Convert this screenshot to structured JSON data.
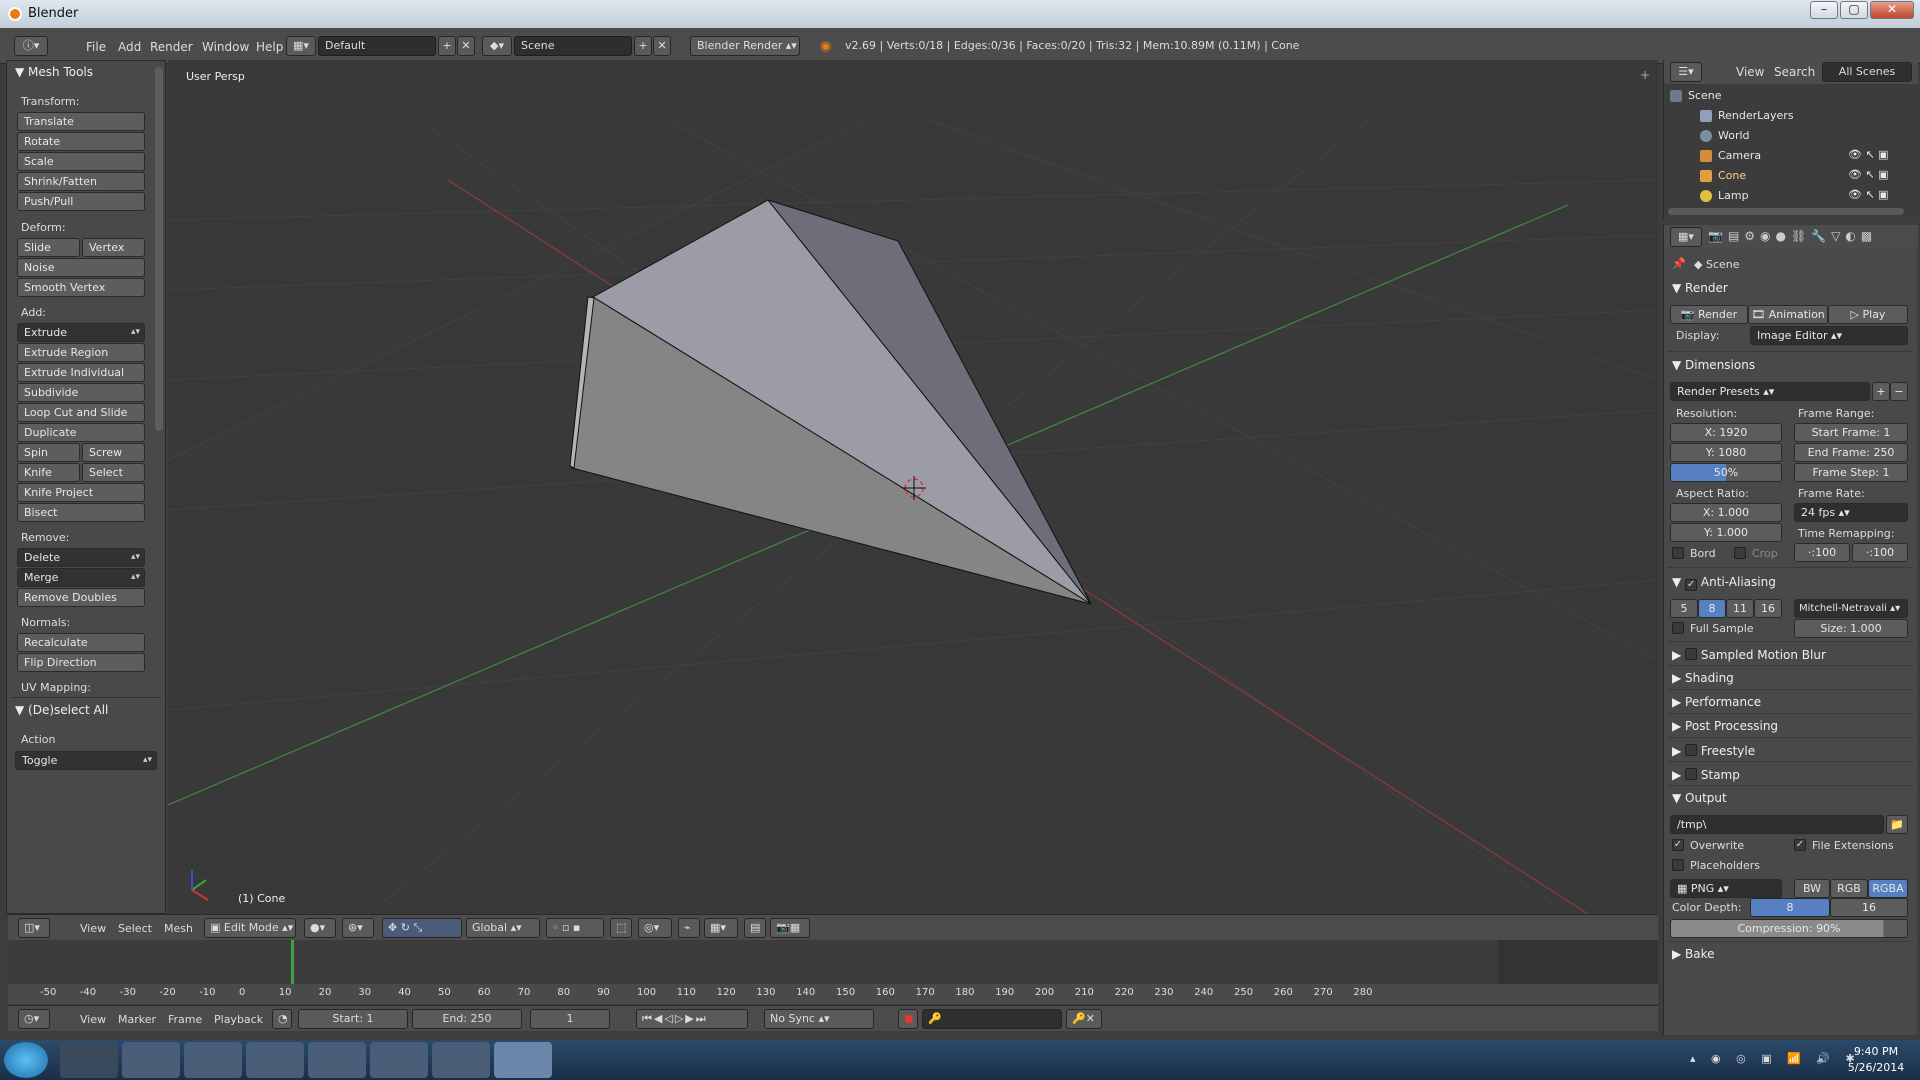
{
  "window": {
    "title": "Blender",
    "min": "–",
    "max": "▢",
    "close": "✕"
  },
  "info_header": {
    "menus": [
      "File",
      "Add",
      "Render",
      "Window",
      "Help"
    ],
    "layout": "Default",
    "scene": "Scene",
    "engine": "Blender Render",
    "stats": "v2.69 | Verts:0/18 | Edges:0/36 | Faces:0/20 | Tris:32 | Mem:10.89M (0.11M) | Cone"
  },
  "toolshelf": {
    "title": "Mesh Tools",
    "transform_label": "Transform:",
    "transform": [
      "Translate",
      "Rotate",
      "Scale",
      "Shrink/Fatten",
      "Push/Pull"
    ],
    "deform_label": "Deform:",
    "slide_edge": "Slide Edge",
    "vertex": "Vertex",
    "noise": "Noise",
    "smooth_vertex": "Smooth Vertex",
    "add_label": "Add:",
    "extrude": "Extrude",
    "extrude_region": "Extrude Region",
    "extrude_individual": "Extrude Individual",
    "subdivide": "Subdivide",
    "loop_cut": "Loop Cut and Slide",
    "duplicate": "Duplicate",
    "spin": "Spin",
    "screw": "Screw",
    "knife": "Knife",
    "select": "Select",
    "knife_project": "Knife Project",
    "bisect": "Bisect",
    "remove_label": "Remove:",
    "delete": "Delete",
    "merge": "Merge",
    "remove_doubles": "Remove Doubles",
    "normals_label": "Normals:",
    "recalculate": "Recalculate",
    "flip_direction": "Flip Direction",
    "uv_label": "UV Mapping:",
    "deselect_title": "(De)select All",
    "action_label": "Action",
    "action_value": "Toggle"
  },
  "viewport": {
    "label": "User Persp",
    "object": "(1) Cone"
  },
  "view3d_header": {
    "menus": [
      "View",
      "Select",
      "Mesh"
    ],
    "mode": "Edit Mode",
    "orientation": "Global"
  },
  "timeline": {
    "ticks": [
      "-50",
      "-40",
      "-30",
      "-20",
      "-10",
      "0",
      "10",
      "20",
      "30",
      "40",
      "50",
      "60",
      "70",
      "80",
      "90",
      "100",
      "110",
      "120",
      "130",
      "140",
      "150",
      "160",
      "170",
      "180",
      "190",
      "200",
      "210",
      "220",
      "230",
      "240",
      "250",
      "260",
      "270",
      "280"
    ],
    "menus": [
      "View",
      "Marker",
      "Frame",
      "Playback"
    ],
    "start": "Start: 1",
    "end": "End: 250",
    "current": "1",
    "sync": "No Sync"
  },
  "outliner": {
    "menus": [
      "View",
      "Search"
    ],
    "scope": "All Scenes",
    "items": [
      "Scene",
      "RenderLayers",
      "World",
      "Camera",
      "Cone",
      "Lamp"
    ]
  },
  "properties": {
    "context": "Scene",
    "render_title": "Render",
    "render_btn": "Render",
    "animation_btn": "Animation",
    "play_btn": "Play",
    "display_label": "Display:",
    "display_value": "Image Editor",
    "dimensions_title": "Dimensions",
    "presets": "Render Presets",
    "resolution_label": "Resolution:",
    "res_x": "X: 1920",
    "res_y": "Y: 1080",
    "res_pct": "50%",
    "frame_range_label": "Frame Range:",
    "start_frame": "Start Frame: 1",
    "end_frame": "End Frame: 250",
    "frame_step": "Frame Step: 1",
    "aspect_label": "Aspect Ratio:",
    "asp_x": "X: 1.000",
    "asp_y": "Y: 1.000",
    "frame_rate_label": "Frame Rate:",
    "fps": "24 fps",
    "time_remap_label": "Time Remapping:",
    "remap_old": "·:100",
    "remap_new": "·:100",
    "bord": "Bord",
    "crop": "Crop",
    "aa_title": "Anti-Aliasing",
    "aa_samples": [
      "5",
      "8",
      "11",
      "16"
    ],
    "aa_filter": "Mitchell-Netravali",
    "full_sample": "Full Sample",
    "size": "Size: 1.000",
    "sampled_motion_blur": "Sampled Motion Blur",
    "shading": "Shading",
    "performance": "Performance",
    "post_processing": "Post Processing",
    "freestyle": "Freestyle",
    "stamp": "Stamp",
    "output_title": "Output",
    "output_path": "/tmp\\",
    "overwrite": "Overwrite",
    "file_extensions": "File Extensions",
    "placeholders": "Placeholders",
    "format": "PNG",
    "bw": "BW",
    "rgb": "RGB",
    "rgba": "RGBA",
    "color_depth_label": "Color Depth:",
    "depth_8": "8",
    "depth_16": "16",
    "compression": "Compression: 90%",
    "bake": "Bake"
  },
  "taskbar": {
    "time": "9:40 PM",
    "date": "5/26/2014"
  },
  "colors": {
    "accent": "#5680c2",
    "x_axis": "#8e3a3a",
    "y_axis": "#3f8a3f",
    "timeline_cursor": "#3fa23f"
  }
}
